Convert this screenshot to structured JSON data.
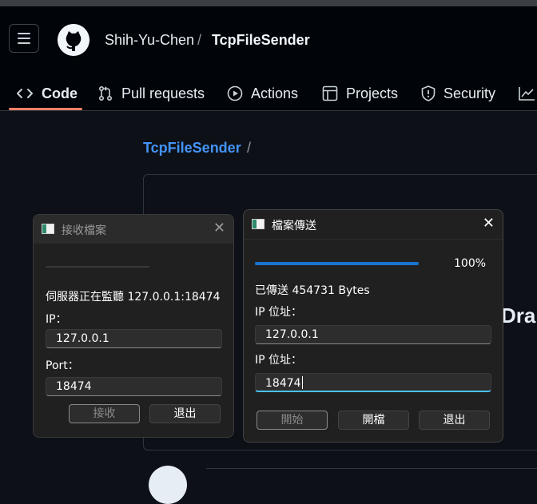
{
  "header": {
    "owner": "Shih-Yu-Chen",
    "separator": "/",
    "repo": "TcpFileSender"
  },
  "nav": {
    "tabs": [
      {
        "label": "Code",
        "icon": "code-icon",
        "active": true
      },
      {
        "label": "Pull requests",
        "icon": "pull-request-icon"
      },
      {
        "label": "Actions",
        "icon": "play-icon"
      },
      {
        "label": "Projects",
        "icon": "table-icon"
      },
      {
        "label": "Security",
        "icon": "shield-icon"
      }
    ]
  },
  "content": {
    "repo_link": "TcpFileSender",
    "slash": "/",
    "readme_heading_fragment": "Dra"
  },
  "receive_dialog": {
    "title": "接收檔案",
    "progress": 0,
    "status": "伺服器正在監聽 127.0.0.1:18474",
    "ip_label": "IP：",
    "ip_value": "127.0.0.1",
    "port_label": "Port：",
    "port_value": "18474",
    "receive_button": "接收",
    "exit_button": "退出"
  },
  "send_dialog": {
    "title": "檔案傳送",
    "progress": 1.0,
    "progress_text": "100%",
    "sent_status": "已傳送 454731 Bytes",
    "ip_label": "IP 位址：",
    "ip_value": "127.0.0.1",
    "port_label": "IP 位址：",
    "port_value": "18474",
    "start_button": "開始",
    "open_button": "開檔",
    "exit_button": "退出"
  },
  "colors": {
    "accent_blue": "#4493f8",
    "tab_underline": "#f78166",
    "progress_fill": "#1b74d0",
    "focus_underline": "#4cc2ff"
  }
}
